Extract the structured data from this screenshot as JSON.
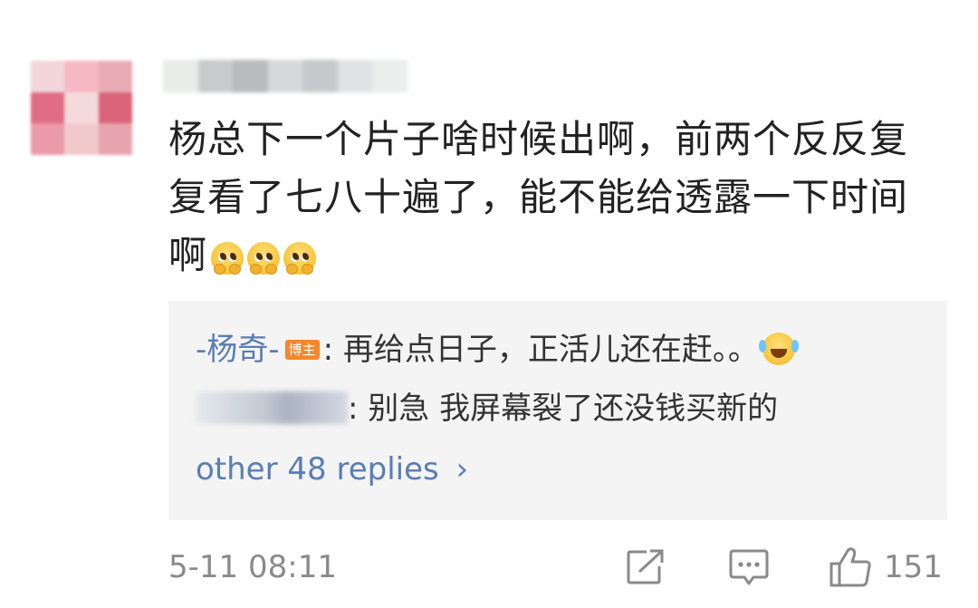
{
  "comment": {
    "text_lines": [
      "杨总下一个片子啥时候出啊，前两个反反复",
      "复看了七八十遍了，能不能给透露一下时间",
      "啊"
    ],
    "emoji": "pleading-face-icon",
    "timestamp": "5-11 08:11",
    "like_count": "151"
  },
  "replies": {
    "items": [
      {
        "author": "-杨奇-",
        "badge": "博主",
        "text": ": 再给点日子，正活儿还在赶。。"
      },
      {
        "text": ": 别急 我屏幕裂了还没钱买新的"
      }
    ],
    "more_label": "other 48 replies",
    "more_chevron": "›"
  },
  "colors": {
    "link": "#5a7db3",
    "reply_bg": "#f4f4f4",
    "muted": "#8a8a8a",
    "badge": "#f5862a"
  }
}
